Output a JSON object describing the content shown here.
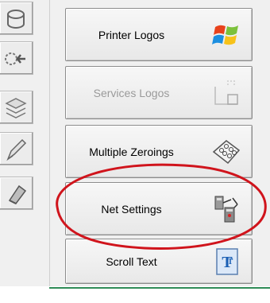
{
  "buttons": {
    "printer_logos": "Printer Logos",
    "services_logos": "Services Logos",
    "multiple_zeroings": "Multiple Zeroings",
    "net_settings": "Net Settings",
    "scroll_text": "Scroll Text"
  },
  "icons": {
    "printer_logos": "windows-logo-icon",
    "services_logos": "services-document-icon",
    "multiple_zeroings": "multiple-zeroings-icon",
    "net_settings": "network-icon",
    "scroll_text": "scroll-text-icon"
  },
  "colors": {
    "annotation": "#d0141c",
    "disabled_text": "#9a9a9a",
    "bottom_line": "#2e8b57"
  }
}
